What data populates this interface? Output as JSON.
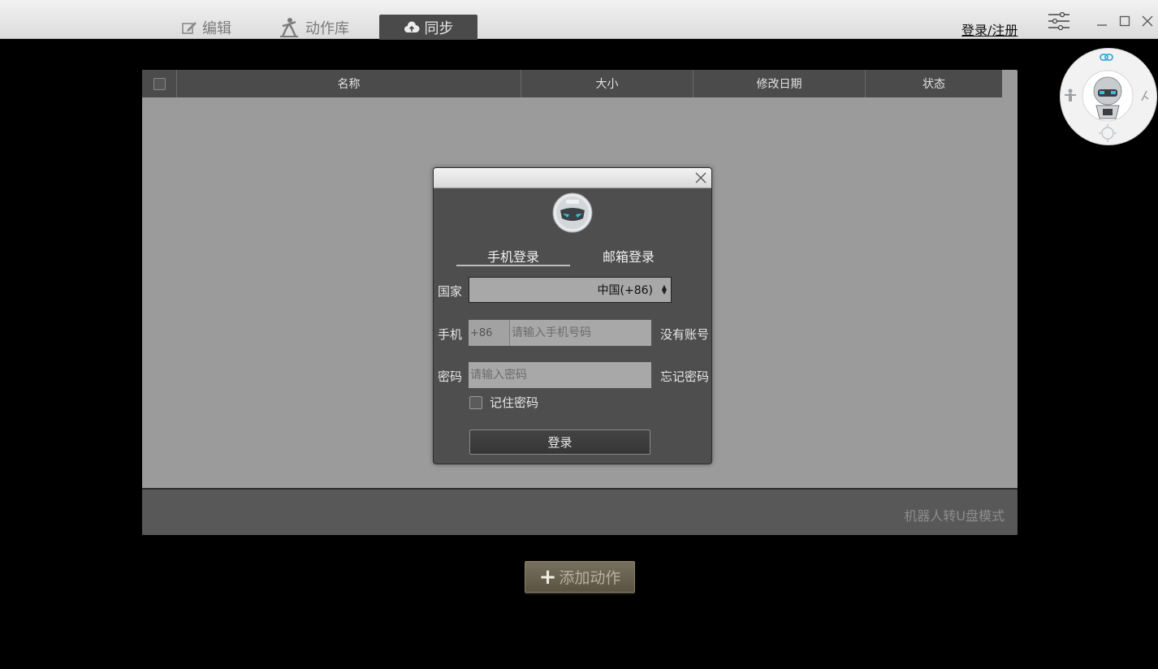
{
  "tabs": [
    {
      "label": "编辑",
      "icon": "edit-icon"
    },
    {
      "label": "动作库",
      "icon": "action-figure-icon"
    },
    {
      "label": "同步",
      "icon": "cloud-sync-icon",
      "active": true
    }
  ],
  "header": {
    "login_register": "登录/注册"
  },
  "table": {
    "columns": [
      "名称",
      "大小",
      "修改日期",
      "状态"
    ],
    "rows": []
  },
  "footer": {
    "udisk_mode": "机器人转U盘模式"
  },
  "add_action": {
    "label": "添加动作"
  },
  "dialog": {
    "tabs": {
      "phone": "手机登录",
      "email": "邮箱登录"
    },
    "country_label": "国家",
    "country_value": "中国(+86)",
    "phone_label": "手机",
    "phone_prefix": "+86",
    "phone_placeholder": "请输入手机号码",
    "no_account": "没有账号",
    "password_label": "密码",
    "password_placeholder": "请输入密码",
    "forgot_password": "忘记密码",
    "remember_password": "记住密码",
    "submit": "登录"
  },
  "colors": {
    "active_tab": "#4a4a4a",
    "panel": "#9b9b9b",
    "dialog": "#4e4e4e",
    "accent_cyan": "#2ec4e0"
  }
}
